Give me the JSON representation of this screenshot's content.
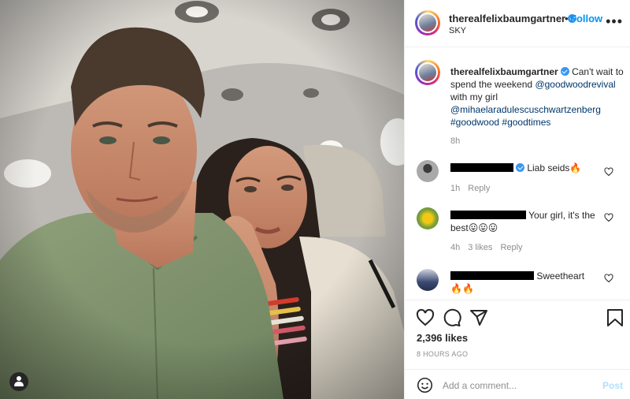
{
  "post": {
    "username": "therealfelixbaumgartner",
    "separator": "•",
    "follow_label": "Follow",
    "location": "SKY",
    "more_label": "•••",
    "caption_text": "Can't wait to spend the weekend",
    "caption_mention_1": "@goodwoodrevival",
    "caption_mid": "with my girl",
    "caption_mention_2": "@mihaelaradulescuschwartzenberg",
    "caption_tags": "#goodwood #goodtimes",
    "caption_time": "8h"
  },
  "comments": [
    {
      "text": "Liab seids",
      "emoji": "🔥",
      "time": "1h",
      "reply_label": "Reply",
      "likes": ""
    },
    {
      "text": "Your girl, it's the best",
      "emoji": "😛😛😛",
      "time": "4h",
      "likes": "3 likes",
      "reply_label": "Reply"
    },
    {
      "text": "Sweetheart",
      "emoji": "🔥🔥",
      "time": "",
      "likes": "",
      "reply_label": ""
    }
  ],
  "stats": {
    "likes": "2,396 likes",
    "time_ago": "8 HOURS AGO"
  },
  "add_comment": {
    "placeholder": "Add a comment...",
    "post_label": "Post"
  },
  "icons": [
    "heart-icon",
    "comment-icon",
    "share-icon",
    "bookmark-icon",
    "emoji-icon",
    "tag-user-icon",
    "verified-icon"
  ],
  "colors": {
    "link": "#00376b",
    "follow": "#0095f6",
    "verified": "#3897f0",
    "muted": "#8e8e8e"
  }
}
